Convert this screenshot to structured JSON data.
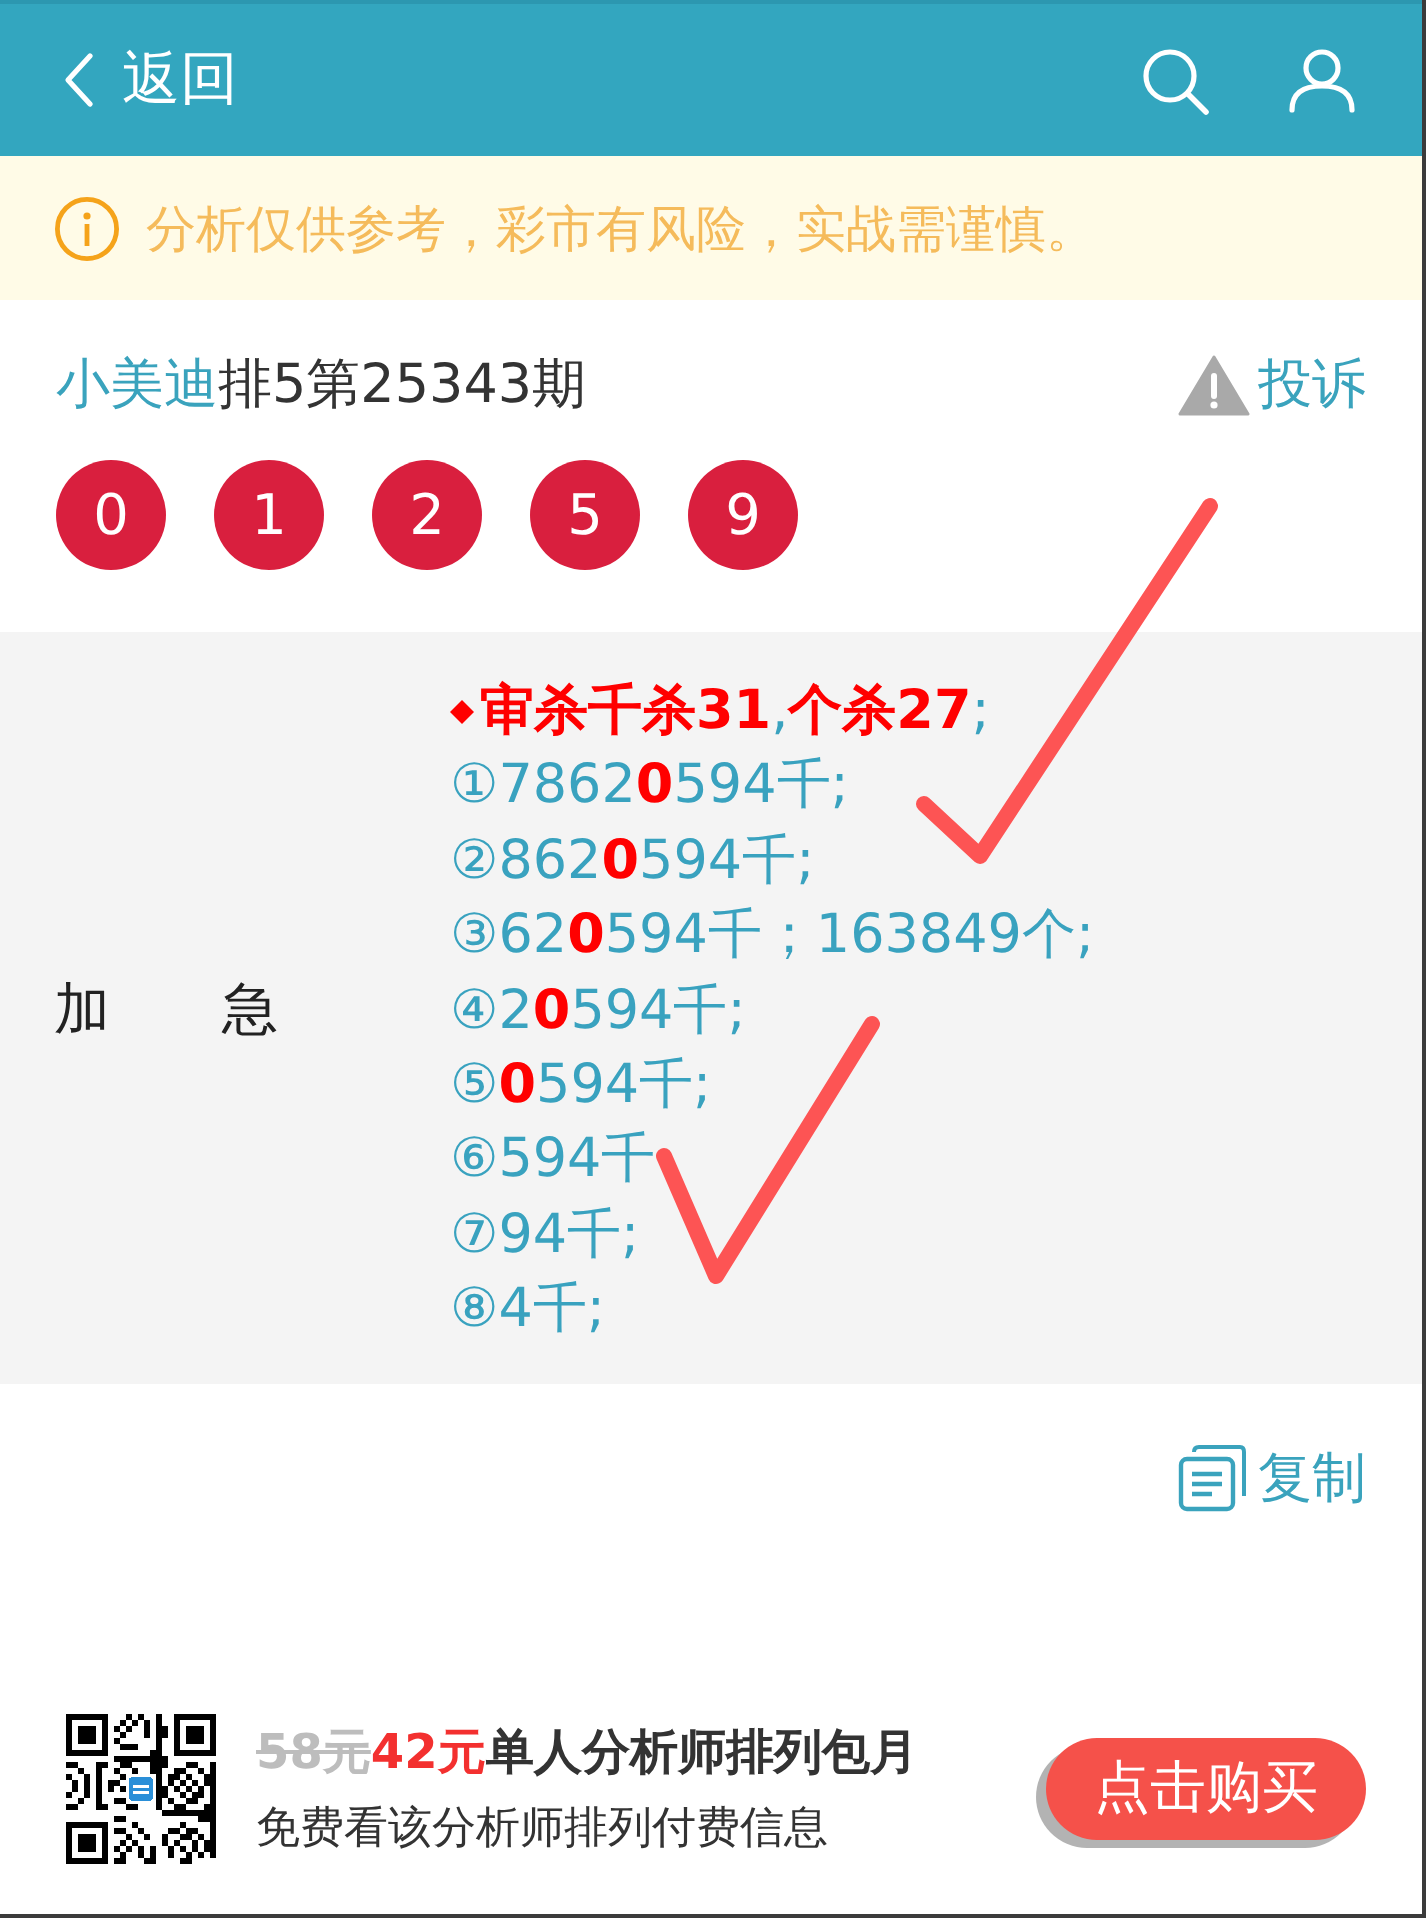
{
  "header": {
    "back": "返回"
  },
  "notice": "分析仅供参考，彩市有风险，实战需谨慎。",
  "issue": {
    "analyst": "小美迪",
    "title": "排5第25343期",
    "report": "投诉"
  },
  "numbers": [
    "0",
    "1",
    "2",
    "5",
    "9"
  ],
  "analysis": {
    "label": "加　　急",
    "lines": [
      {
        "kind": "bullet",
        "text": "**审杀千杀31**,**个杀27**;"
      },
      {
        "kind": "plain",
        "text": "①7862**0**594千;"
      },
      {
        "kind": "plain",
        "text": "②862**0**594千;"
      },
      {
        "kind": "plain",
        "text": "③62**0**594千；163849个;"
      },
      {
        "kind": "plain",
        "text": "④2**0**594千;"
      },
      {
        "kind": "plain",
        "text": "⑤**0**594千;"
      },
      {
        "kind": "plain",
        "text": "⑥594千"
      },
      {
        "kind": "plain",
        "text": "⑦94千;"
      },
      {
        "kind": "plain",
        "text": "⑧4千;"
      }
    ]
  },
  "copy": "复制",
  "promo": {
    "old_price": "58元",
    "price": "42元",
    "title": "单人分析师排列包月",
    "subtitle": "免费看该分析师排列付费信息",
    "button": "点击购买"
  }
}
